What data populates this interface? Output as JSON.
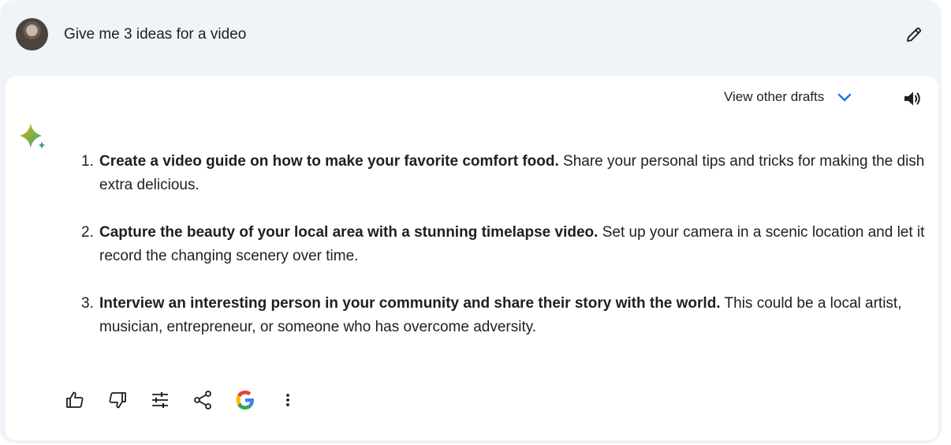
{
  "prompt": {
    "text": "Give me 3 ideas for a video"
  },
  "response": {
    "drafts_label": "View other drafts",
    "ideas": [
      {
        "number": "1.",
        "bold": "Create a video guide on how to make your favorite comfort food.",
        "rest": "Share your personal tips and tricks for making the dish extra delicious."
      },
      {
        "number": "2.",
        "bold": "Capture the beauty of your local area with a stunning timelapse video.",
        "rest": "Set up your camera in a scenic location and let it record the changing scenery over time."
      },
      {
        "number": "3.",
        "bold": "Interview an interesting person in your community and share their story with the world.",
        "rest": "This could be a local artist, musician, entrepreneur, or someone who has overcome adversity."
      }
    ]
  },
  "icons": {
    "edit": "pencil-icon",
    "drafts_toggle": "chevron-down-icon",
    "read_aloud": "speaker-icon",
    "assistant": "sparkle-icon",
    "actions": [
      "thumbs-up-icon",
      "thumbs-down-icon",
      "tune-icon",
      "share-icon",
      "google-icon",
      "more-vert-icon"
    ]
  },
  "colors": {
    "page_background": "#f0f4f9",
    "card_background": "#ffffff",
    "text": "#1f1f1f",
    "accent_blue": "#1a73e8"
  }
}
